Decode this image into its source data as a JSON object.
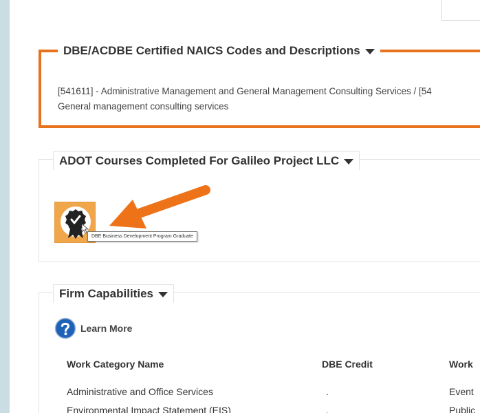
{
  "naics": {
    "title": "DBE/ACDBE Certified NAICS Codes and Descriptions",
    "line1": "[541611] - Administrative Management and General Management Consulting Services / [54",
    "line2": "General management consulting services"
  },
  "adot": {
    "title": "ADOT Courses Completed For Galileo Project LLC",
    "badge_tooltip": "DBE Business Development Program Graduate"
  },
  "firm": {
    "title": "Firm Capabilities",
    "learn_more": "Learn More",
    "columns": [
      "Work Category Name",
      "DBE Credit",
      "Work"
    ],
    "rows": [
      [
        "Administrative and Office Services",
        ".",
        "Event"
      ],
      [
        "Environmental Impact Statement (EIS)",
        ".",
        "Public"
      ]
    ]
  },
  "colors": {
    "accent_orange": "#e8721c",
    "badge_tile": "#f0a64b",
    "help_blue": "#1e62b8",
    "page_background": "#c9dde3"
  }
}
